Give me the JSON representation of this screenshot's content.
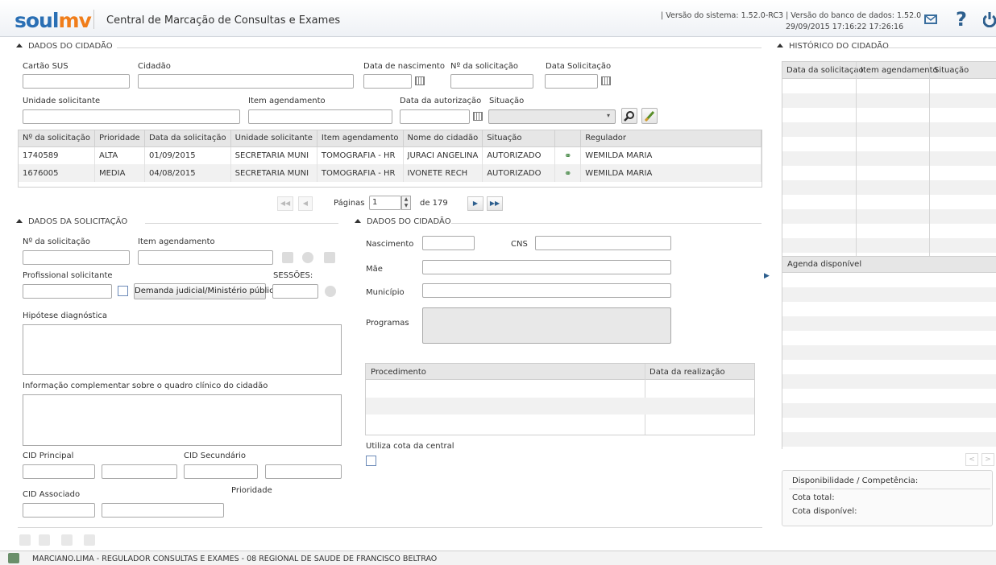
{
  "header": {
    "logo_soul": "soul",
    "logo_mv": "mv",
    "title": "Central de Marcação de Consultas e Exames",
    "version_line1": "| Versão do sistema: 1.52.0-RC3 | Versão do banco de dados: 1.52.0",
    "version_line2": "29/09/2015 17:16:22   17:26:16"
  },
  "dados_cidadao": {
    "section_title": "DADOS DO CIDADÃO",
    "cartao_sus": "Cartão SUS",
    "cidadao": "Cidadão",
    "data_nascimento": "Data de nascimento",
    "num_solicitacao": "Nº da solicitação",
    "data_solicitacao": "Data Solicitação",
    "unidade_solicitante": "Unidade solicitante",
    "item_agendamento": "Item agendamento",
    "data_autorizacao": "Data da autorização",
    "situacao": "Situação"
  },
  "results_table": {
    "headers": [
      "Nº da solicitação",
      "Prioridade",
      "Data da solicitação",
      "Unidade solicitante",
      "Item agendamento",
      "Nome do cidadão",
      "Situação",
      "",
      "Regulador"
    ],
    "rows": [
      [
        "1740589",
        "ALTA",
        "01/09/2015",
        "SECRETARIA MUNI",
        "TOMOGRAFIA - HR",
        "JURACI ANGELINA",
        "AUTORIZADO",
        "",
        "WEMILDA MARIA"
      ],
      [
        "1676005",
        "MEDIA",
        "04/08/2015",
        "SECRETARIA MUNI",
        "TOMOGRAFIA - HR",
        "IVONETE RECH",
        "AUTORIZADO",
        "",
        "WEMILDA MARIA"
      ]
    ]
  },
  "pagination": {
    "label": "Páginas",
    "current": "1",
    "of_label": "de 179"
  },
  "dados_solicitacao": {
    "section_title": "DADOS DA SOLICITAÇÃO",
    "num_solicitacao": "Nº da solicitação",
    "item_agendamento": "Item agendamento",
    "profissional": "Profissional solicitante",
    "demanda_button": "Demanda judicial/Ministério público",
    "sessoes": "SESSÕES:",
    "hipotese": "Hipótese diagnóstica",
    "info_complementar": "Informação complementar sobre o quadro clínico do cidadão",
    "cid_principal": "CID Principal",
    "cid_secundario": "CID Secundário",
    "cid_associado": "CID Associado",
    "prioridade": "Prioridade"
  },
  "dados_cidadao_2": {
    "section_title": "DADOS DO CIDADÃO",
    "nascimento": "Nascimento",
    "cns": "CNS",
    "mae": "Mãe",
    "municipio": "Município",
    "programas": "Programas",
    "proc_headers": [
      "Procedimento",
      "Data da realização"
    ],
    "utiliza_cota": "Utiliza cota da central"
  },
  "historico": {
    "section_title": "HISTÓRICO DO CIDADÃO",
    "headers": [
      "Data da solicitaçao",
      "Item agendamento",
      "Situação"
    ],
    "agenda_label": "Agenda disponível",
    "disponibilidade": "Disponibilidade / Competência:",
    "cota_total": "Cota total:",
    "cota_disponivel": "Cota disponível:"
  },
  "status_bar": {
    "user": "MARCIANO.LIMA - REGULADOR CONSULTAS E EXAMES - 08 REGIONAL DE SAUDE DE FRANCISCO BELTRAO"
  },
  "colors": {
    "logo_blue": "#2a6fb4",
    "logo_orange": "#f07d1a",
    "grid_header": "#e6e6e6",
    "row_alt": "#f1f1f1"
  }
}
